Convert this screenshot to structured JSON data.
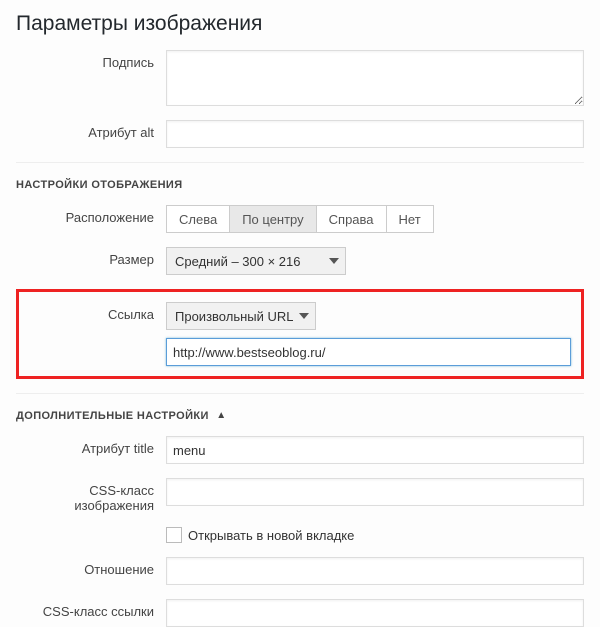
{
  "page_title": "Параметры изображения",
  "caption": {
    "label": "Подпись",
    "value": ""
  },
  "alt": {
    "label": "Атрибут alt",
    "value": ""
  },
  "display_section": "НАСТРОЙКИ ОТОБРАЖЕНИЯ",
  "alignment": {
    "label": "Расположение",
    "options": [
      "Слева",
      "По центру",
      "Справа",
      "Нет"
    ],
    "selected": "По центру"
  },
  "size": {
    "label": "Размер",
    "selected": "Средний – 300 × 216"
  },
  "link": {
    "label": "Ссылка",
    "type_selected": "Произвольный URL",
    "url": "http://www.bestseoblog.ru/"
  },
  "advanced_section": "ДОПОЛНИТЕЛЬНЫЕ НАСТРОЙКИ",
  "title_attr": {
    "label": "Атрибут title",
    "value": "menu"
  },
  "css_image": {
    "label": "CSS-класс изображения",
    "value": ""
  },
  "new_tab": {
    "label": "Открывать в новой вкладке",
    "checked": false
  },
  "rel": {
    "label": "Отношение",
    "value": ""
  },
  "css_link": {
    "label": "CSS-класс ссылки",
    "value": ""
  }
}
